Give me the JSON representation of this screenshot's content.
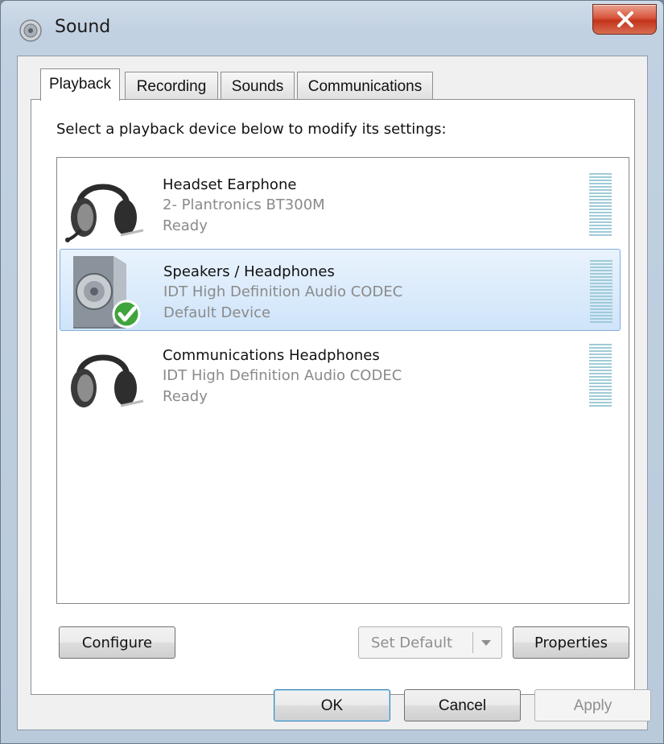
{
  "window": {
    "title": "Sound"
  },
  "tabs": [
    "Playback",
    "Recording",
    "Sounds",
    "Communications"
  ],
  "instruction": "Select a playback device below to modify its settings:",
  "devices": [
    {
      "name": "Headset Earphone",
      "description": "2- Plantronics BT300M",
      "status": "Ready",
      "icon": "headset-icon",
      "selected": false
    },
    {
      "name": "Speakers / Headphones",
      "description": "IDT High Definition Audio CODEC",
      "status": "Default Device",
      "icon": "speaker-icon",
      "selected": true
    },
    {
      "name": "Communications Headphones",
      "description": "IDT High Definition Audio CODEC",
      "status": "Ready",
      "icon": "headset-icon",
      "selected": false
    }
  ],
  "buttons": {
    "configure": "Configure",
    "set_default": "Set Default",
    "properties": "Properties",
    "ok": "OK",
    "cancel": "Cancel",
    "apply": "Apply"
  },
  "colors": {
    "selection": "#cfe4fa",
    "meter": "#9fcbd7",
    "close": "#c2341b"
  }
}
